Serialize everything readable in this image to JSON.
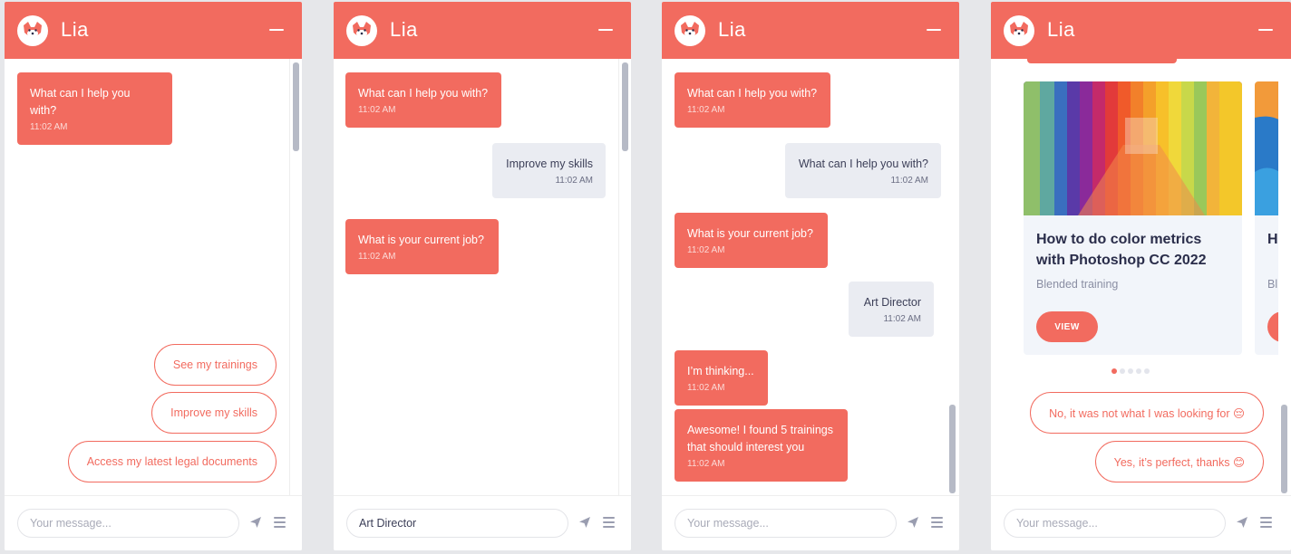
{
  "bot_name": "Lia",
  "colors": {
    "accent": "#f26b5f",
    "user_bubble": "#eaecf2",
    "scrollbar": "#b6bac6"
  },
  "icons": {
    "avatar": "fox-icon",
    "minimize": "minimize-icon",
    "send": "paper-plane-icon",
    "menu": "hamburger-menu-icon"
  },
  "input_placeholder": "Your message...",
  "panel1": {
    "messages": [
      {
        "sender": "bot",
        "text": "What can I help you with?",
        "time": "11:02 AM"
      }
    ],
    "quick_replies": [
      "See my trainings",
      "Improve my skills",
      "Access my latest legal documents"
    ],
    "input_value": ""
  },
  "panel2": {
    "messages": [
      {
        "sender": "bot",
        "text": "What can I help you with?",
        "time": "11:02 AM"
      },
      {
        "sender": "user",
        "text": "Improve my skills",
        "time": "11:02 AM"
      },
      {
        "sender": "bot",
        "text": "What is your current job?",
        "time": "11:02 AM"
      }
    ],
    "input_value": "Art Director"
  },
  "panel3": {
    "messages": [
      {
        "sender": "bot",
        "text": "What can I help you with?",
        "time": "11:02 AM"
      },
      {
        "sender": "user",
        "text": "What can I help you with?",
        "time": "11:02 AM"
      },
      {
        "sender": "bot",
        "text": "What is your current job?",
        "time": "11:02 AM"
      },
      {
        "sender": "user",
        "text": "Art Director",
        "time": "11:02 AM"
      },
      {
        "sender": "bot",
        "text": "I’m thinking...",
        "time": "11:02 AM"
      },
      {
        "sender": "bot",
        "text": "Awesome! I found 5 trainings that should interest you",
        "time": "11:02 AM"
      }
    ],
    "input_value": ""
  },
  "panel4": {
    "cards": [
      {
        "title": "How to do color metrics with Photoshop CC 2022",
        "subtitle": "Blended training",
        "button": "VIEW"
      },
      {
        "title": "H w",
        "subtitle": "Bl",
        "button": "VIEW"
      }
    ],
    "carousel": {
      "total": 5,
      "active": 1
    },
    "quick_replies": [
      "No, it was not what I was looking for 😔",
      "Yes, it’s perfect, thanks 😊"
    ],
    "input_value": ""
  }
}
